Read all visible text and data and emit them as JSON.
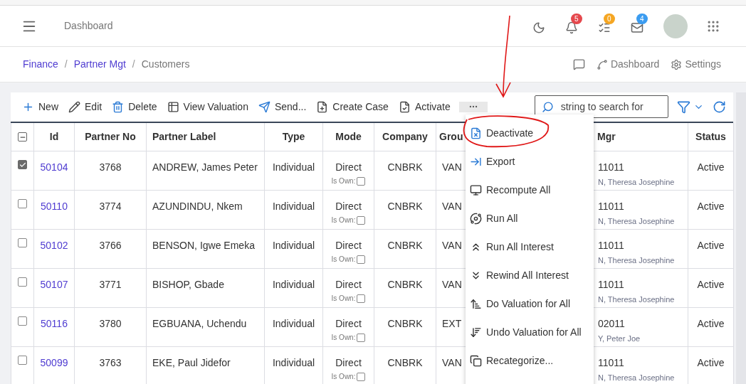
{
  "header": {
    "title": "Dashboard",
    "badges": [
      {
        "kind": "bell",
        "count": "5",
        "color": "#e5484d"
      },
      {
        "kind": "tasks",
        "count": "0",
        "color": "#f5a623"
      },
      {
        "kind": "mail",
        "count": "4",
        "color": "#3b9cf0"
      }
    ]
  },
  "breadcrumb_separator": "/",
  "breadcrumb": [
    {
      "label": "Finance",
      "kind": "link"
    },
    {
      "label": "Partner Mgt",
      "kind": "link"
    },
    {
      "label": "Customers",
      "kind": "current"
    }
  ],
  "page_links": [
    "Dashboard",
    "Settings"
  ],
  "toolbar": {
    "buttons": [
      {
        "kind": "new",
        "label": "New"
      },
      {
        "kind": "edit",
        "label": "Edit"
      },
      {
        "kind": "delete",
        "label": "Delete"
      },
      {
        "kind": "valuation",
        "label": "View Valuation"
      },
      {
        "kind": "send",
        "label": "Send..."
      },
      {
        "kind": "case",
        "label": "Create Case"
      },
      {
        "kind": "activate",
        "label": "Activate"
      }
    ],
    "search": {
      "placeholder": "string to search for"
    }
  },
  "menu": [
    {
      "kind": "deactivate",
      "label": "Deactivate"
    },
    {
      "kind": "export",
      "label": "Export"
    },
    {
      "kind": "recompute",
      "label": "Recompute All"
    },
    {
      "kind": "run",
      "label": "Run All"
    },
    {
      "kind": "up",
      "label": "Run All Interest"
    },
    {
      "kind": "down",
      "label": "Rewind All Interest"
    },
    {
      "kind": "sortup",
      "label": "Do Valuation for All"
    },
    {
      "kind": "sortdown",
      "label": "Undo Valuation for All"
    },
    {
      "kind": "copy",
      "label": "Recategorize..."
    }
  ],
  "table": {
    "select_all_partial": true,
    "columns": [
      "Id",
      "Partner No",
      "Partner Label",
      "Type",
      "Mode",
      "Company",
      "Grou",
      "Mgr",
      "Status"
    ],
    "rows": [
      {
        "selected": true,
        "id": "50104",
        "partner_no": "3768",
        "label": "ANDREW, James Peter",
        "type": "Individual",
        "mode": "Direct",
        "is_own_label": "Is Own:",
        "is_own": false,
        "company": "CNBRK",
        "group": "VAN",
        "mgr_code": "11011",
        "mgr_name": "N, Theresa Josephine",
        "status": "Active"
      },
      {
        "selected": false,
        "id": "50110",
        "partner_no": "3774",
        "label": "AZUNDINDU, Nkem",
        "type": "Individual",
        "mode": "Direct",
        "is_own_label": "Is Own:",
        "is_own": false,
        "company": "CNBRK",
        "group": "VAN",
        "mgr_code": "11011",
        "mgr_name": "N, Theresa Josephine",
        "status": "Active"
      },
      {
        "selected": false,
        "id": "50102",
        "partner_no": "3766",
        "label": "BENSON, Igwe Emeka",
        "type": "Individual",
        "mode": "Direct",
        "is_own_label": "Is Own:",
        "is_own": false,
        "company": "CNBRK",
        "group": "VAN",
        "mgr_code": "11011",
        "mgr_name": "N, Theresa Josephine",
        "status": "Active"
      },
      {
        "selected": false,
        "id": "50107",
        "partner_no": "3771",
        "label": "BISHOP, Gbade",
        "type": "Individual",
        "mode": "Direct",
        "is_own_label": "Is Own:",
        "is_own": false,
        "company": "CNBRK",
        "group": "VAN",
        "mgr_code": "11011",
        "mgr_name": "N, Theresa Josephine",
        "status": "Active"
      },
      {
        "selected": false,
        "id": "50116",
        "partner_no": "3780",
        "label": "EGBUANA, Uchendu",
        "type": "Individual",
        "mode": "Direct",
        "is_own_label": "Is Own:",
        "is_own": false,
        "company": "CNBRK",
        "group": "EXT",
        "mgr_code": "02011",
        "mgr_name": "Y, Peter Joe",
        "status": "Active"
      },
      {
        "selected": false,
        "id": "50099",
        "partner_no": "3763",
        "label": "EKE, Paul Jidefor",
        "type": "Individual",
        "mode": "Direct",
        "is_own_label": "Is Own:",
        "is_own": false,
        "company": "CNBRK",
        "group": "VAN",
        "mgr_code": "11011",
        "mgr_name": "N, Theresa Josephine",
        "status": "Active"
      }
    ]
  }
}
